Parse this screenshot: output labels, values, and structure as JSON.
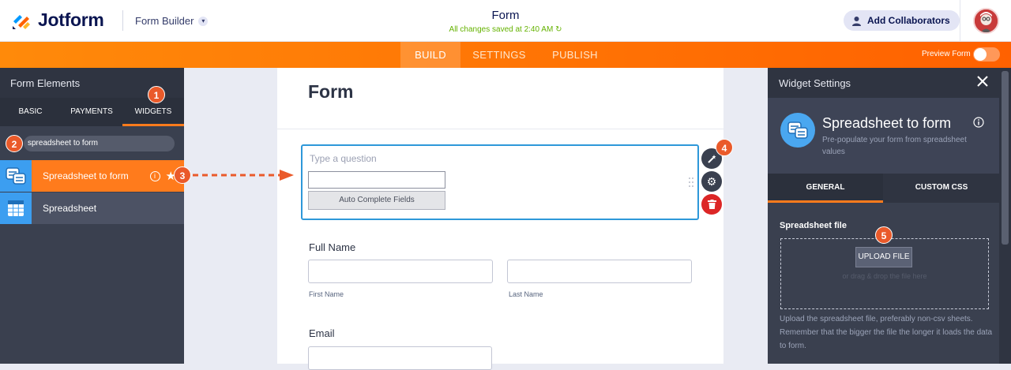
{
  "header": {
    "brand": "Jotform",
    "builder_label": "Form Builder",
    "form_title": "Form",
    "saved_status": "All changes saved at 2:40 AM",
    "add_collaborators": "Add Collaborators"
  },
  "nav": {
    "tabs": [
      {
        "label": "BUILD",
        "active": true
      },
      {
        "label": "SETTINGS",
        "active": false
      },
      {
        "label": "PUBLISH",
        "active": false
      }
    ],
    "preview_label": "Preview Form",
    "preview_on": false
  },
  "left_panel": {
    "title": "Form Elements",
    "tabs": [
      {
        "label": "BASIC"
      },
      {
        "label": "PAYMENTS"
      },
      {
        "label": "WIDGETS"
      }
    ],
    "search_value": "spreadsheet to form",
    "items": [
      {
        "label": "Spreadsheet to form",
        "icon": "spreadsheet-to-form-icon"
      },
      {
        "label": "Spreadsheet",
        "icon": "spreadsheet-grid-icon"
      }
    ]
  },
  "canvas": {
    "title": "Form",
    "widget": {
      "placeholder": "Type a question",
      "button_label": "Auto Complete Fields"
    },
    "full_name": {
      "label": "Full Name",
      "first_label": "First Name",
      "last_label": "Last Name"
    },
    "email": {
      "label": "Email"
    }
  },
  "right_panel": {
    "title": "Widget Settings",
    "widget_name": "Spreadsheet to form",
    "widget_desc": "Pre-populate your form from spreadsheet values",
    "tabs": [
      {
        "label": "GENERAL",
        "active": true
      },
      {
        "label": "CUSTOM CSS",
        "active": false
      }
    ],
    "file_label": "Spreadsheet file",
    "upload_label": "UPLOAD FILE",
    "drop_hint": "or drag & drop the file here",
    "help_text": "Upload the spreadsheet file, preferably non-csv sheets. Remember that the bigger the file the longer it loads the data to form."
  },
  "annotations": {
    "step1": "1",
    "step2": "2",
    "step3": "3",
    "step4": "4",
    "step5": "5"
  },
  "colors": {
    "accent_orange": "#ff7b1c",
    "annotation": "#ea5a2a",
    "brand_navy": "#0a1551",
    "saved_green": "#64b200",
    "widget_blue": "#3c9ef0"
  }
}
